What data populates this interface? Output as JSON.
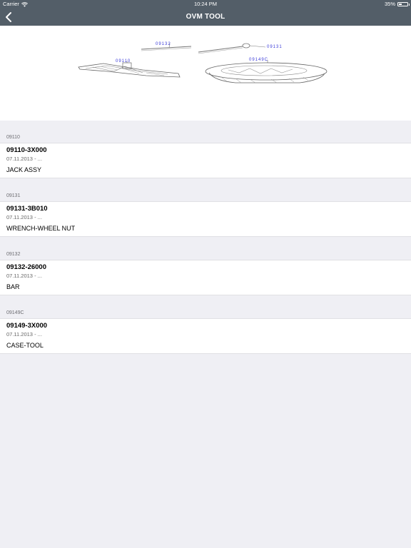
{
  "status": {
    "carrier": "Carrier",
    "time": "10:24 PM",
    "battery": "35%"
  },
  "nav": {
    "title": "OVM TOOL"
  },
  "illustration": {
    "labels": [
      "09132",
      "09131",
      "09110",
      "09149C"
    ]
  },
  "sections": [
    {
      "header": "09110",
      "part_no": "09110-3X000",
      "date": "07.11.2013 - ...",
      "name": "JACK ASSY"
    },
    {
      "header": "09131",
      "part_no": "09131-3B010",
      "date": "07.11.2013 - ...",
      "name": "WRENCH-WHEEL NUT"
    },
    {
      "header": "09132",
      "part_no": "09132-26000",
      "date": "07.11.2013 - ...",
      "name": "BAR"
    },
    {
      "header": "09149C",
      "part_no": "09149-3X000",
      "date": "07.11.2013 - ...",
      "name": "CASE-TOOL"
    }
  ],
  "colors": {
    "navbar": "#535e68",
    "background": "#efeff4",
    "label_blue": "#3a3ad8"
  }
}
